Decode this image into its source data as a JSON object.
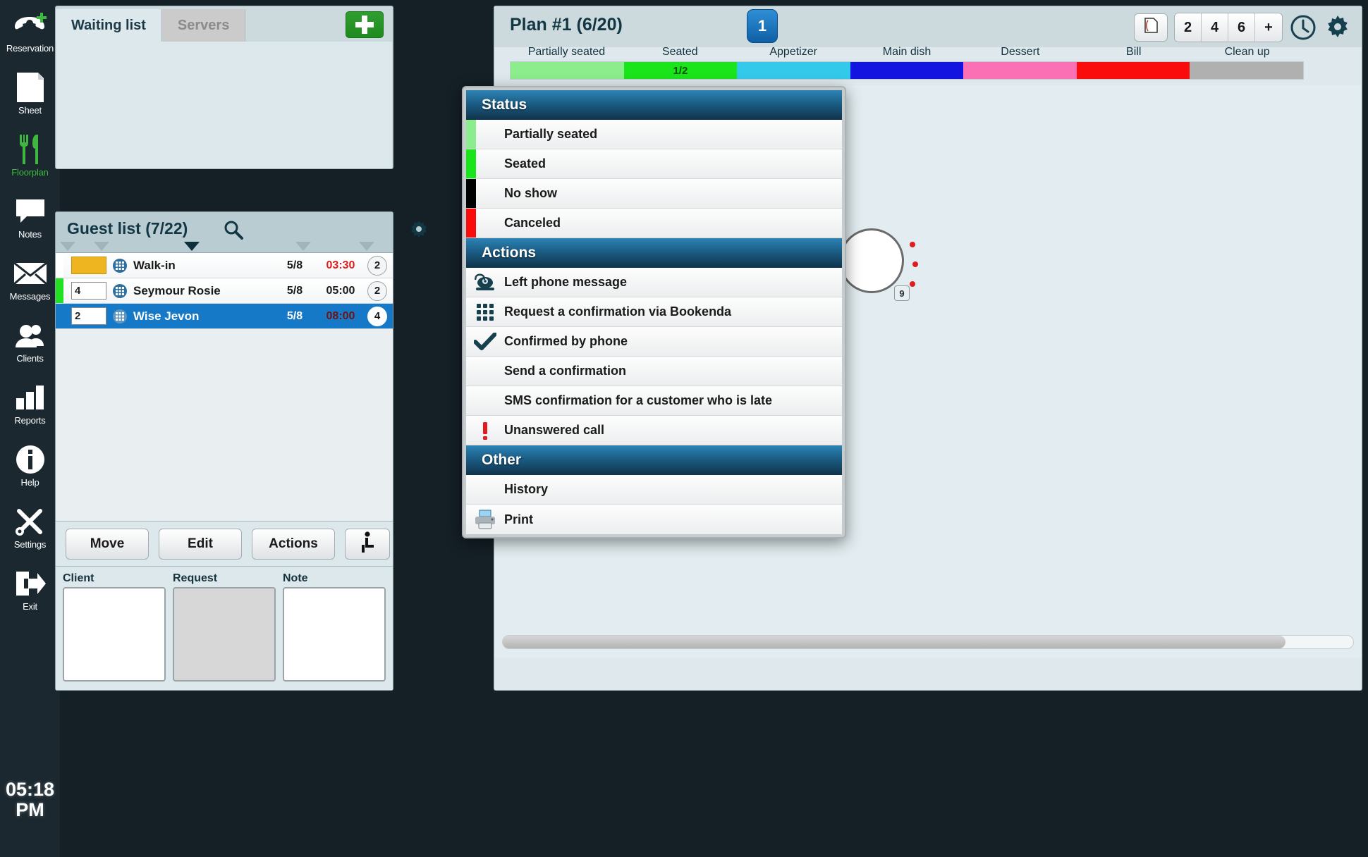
{
  "sidebar": {
    "items": [
      {
        "label": "Reservation",
        "icon": "phone-plus-icon",
        "accent": "white"
      },
      {
        "label": "Sheet",
        "icon": "sheet-icon",
        "accent": "white"
      },
      {
        "label": "Floorplan",
        "icon": "fork-knife-icon",
        "accent": "green"
      },
      {
        "label": "Notes",
        "icon": "speech-bubble-icon",
        "accent": "white"
      },
      {
        "label": "Messages",
        "icon": "envelope-icon",
        "accent": "white"
      },
      {
        "label": "Clients",
        "icon": "people-icon",
        "accent": "white"
      },
      {
        "label": "Reports",
        "icon": "bar-chart-icon",
        "accent": "white"
      },
      {
        "label": "Help",
        "icon": "info-circle-icon",
        "accent": "white"
      },
      {
        "label": "Settings",
        "icon": "tools-icon",
        "accent": "white"
      },
      {
        "label": "Exit",
        "icon": "exit-door-icon",
        "accent": "white"
      }
    ],
    "clock": {
      "time": "05:18",
      "meridiem": "PM"
    }
  },
  "waiting_panel": {
    "tabs": [
      {
        "label": "Waiting list",
        "active": true
      },
      {
        "label": "Servers",
        "active": false
      }
    ],
    "add_label": "+"
  },
  "guest_list": {
    "title": "Guest list (7/22)",
    "search_icon": "search-icon",
    "gear_icon": "gear-icon",
    "rows": [
      {
        "table": "",
        "table_empty": true,
        "status_color": "#ffffff",
        "name": "Walk-in",
        "date": "5/8",
        "time": "03:30",
        "time_style": "red",
        "count": "2"
      },
      {
        "table": "4",
        "table_empty": false,
        "status_color": "#22e022",
        "name": "Seymour Rosie",
        "date": "5/8",
        "time": "05:00",
        "time_style": "normal",
        "count": "2"
      },
      {
        "table": "2",
        "table_empty": false,
        "status_color": "#1579c8",
        "name": "Wise Jevon",
        "date": "5/8",
        "time": "08:00",
        "time_style": "dark",
        "count": "4",
        "selected": true
      }
    ],
    "buttons": [
      {
        "label": "Move",
        "name": "move-button"
      },
      {
        "label": "Edit",
        "name": "edit-button"
      },
      {
        "label": "Actions",
        "name": "actions-button"
      }
    ],
    "seat_button_icon": "seated-person-icon",
    "fields": [
      {
        "label": "Client",
        "value": "",
        "disabled": false
      },
      {
        "label": "Request",
        "value": "",
        "disabled": true
      },
      {
        "label": "Note",
        "value": "",
        "disabled": false
      }
    ]
  },
  "plan": {
    "title": "Plan #1 (6/20)",
    "badge": "1",
    "tools": {
      "page_icon": "page-flip-icon",
      "seat_counts": [
        "2",
        "4",
        "6",
        "+"
      ],
      "clock_icon": "clock-icon",
      "gear_icon": "gear-icon"
    },
    "legend": [
      {
        "label": "Partially seated",
        "color": "#8ced8c",
        "fraction": ""
      },
      {
        "label": "Seated",
        "color": "#1ae41a",
        "fraction": "1/2"
      },
      {
        "label": "Appetizer",
        "color": "#33c9ea",
        "fraction": ""
      },
      {
        "label": "Main dish",
        "color": "#1414e0",
        "fraction": ""
      },
      {
        "label": "Dessert",
        "color": "#fb6fb4",
        "fraction": ""
      },
      {
        "label": "Bill",
        "color": "#fa0c0c",
        "fraction": ""
      },
      {
        "label": "Clean up",
        "color": "#b0b0b0",
        "fraction": ""
      }
    ],
    "tables": [
      {
        "number": "9",
        "shape": "round",
        "chairs": 3
      }
    ]
  },
  "context_menu": {
    "sections": [
      {
        "header": "Status",
        "items": [
          {
            "label": "Partially seated",
            "swatch": "#8ced8c",
            "icon": ""
          },
          {
            "label": "Seated",
            "swatch": "#1ae41a",
            "icon": ""
          },
          {
            "label": "No show",
            "swatch": "#000000",
            "icon": ""
          },
          {
            "label": "Canceled",
            "swatch": "#fa0c0c",
            "icon": ""
          }
        ]
      },
      {
        "header": "Actions",
        "items": [
          {
            "label": "Left phone message",
            "swatch": "",
            "icon": "telephone-icon"
          },
          {
            "label": "Request a confirmation via Bookenda",
            "swatch": "",
            "icon": "keypad-icon"
          },
          {
            "label": "Confirmed by phone",
            "swatch": "",
            "icon": "checkmark-icon"
          },
          {
            "label": "Send a confirmation",
            "swatch": "",
            "icon": ""
          },
          {
            "label": "SMS confirmation for a customer who is late",
            "swatch": "",
            "icon": ""
          },
          {
            "label": "Unanswered call",
            "swatch": "",
            "icon": "exclamation-icon"
          }
        ]
      },
      {
        "header": "Other",
        "items": [
          {
            "label": "History",
            "swatch": "",
            "icon": ""
          },
          {
            "label": "Print",
            "swatch": "",
            "icon": "printer-icon"
          }
        ]
      }
    ]
  }
}
